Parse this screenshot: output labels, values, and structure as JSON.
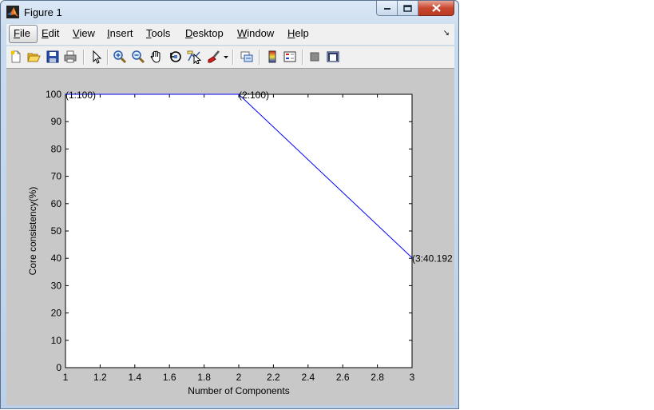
{
  "window": {
    "title": "Figure 1"
  },
  "menu": {
    "items": [
      {
        "mnemonic": "F",
        "rest": "ile"
      },
      {
        "mnemonic": "E",
        "rest": "dit"
      },
      {
        "mnemonic": "V",
        "rest": "iew"
      },
      {
        "mnemonic": "I",
        "rest": "nsert"
      },
      {
        "mnemonic": "T",
        "rest": "ools"
      },
      {
        "mnemonic": "D",
        "rest": "esktop"
      },
      {
        "mnemonic": "W",
        "rest": "indow"
      },
      {
        "mnemonic": "H",
        "rest": "elp"
      }
    ],
    "dock_arrow": "↘"
  },
  "toolbar": {
    "icons": [
      "new-figure-icon",
      "open-file-icon",
      "save-figure-icon",
      "print-figure-icon",
      "edit-plot-icon",
      "zoom-in-icon",
      "zoom-out-icon",
      "pan-icon",
      "rotate-3d-icon",
      "data-cursor-icon",
      "brush-icon",
      "brush-dropdown-icon",
      "link-plot-icon",
      "insert-colorbar-icon",
      "insert-legend-icon",
      "hide-plot-tools-icon",
      "show-plot-tools-icon"
    ]
  },
  "chart_data": {
    "type": "line",
    "x": [
      1,
      2,
      3
    ],
    "series": [
      {
        "values": [
          100,
          100,
          40.192
        ],
        "color": "#0000ff"
      }
    ],
    "data_labels": [
      "(1:100)",
      "(2:100)",
      "(3:40.192"
    ],
    "title": "",
    "xlabel": "Number of Components",
    "ylabel": "Core consistency(%)",
    "xlim": [
      1,
      3
    ],
    "ylim": [
      0,
      100
    ],
    "xticks": [
      1,
      1.2,
      1.4,
      1.6,
      1.8,
      2,
      2.2,
      2.4,
      2.6,
      2.8,
      3
    ],
    "xtick_labels": [
      "1",
      "1.2",
      "1.4",
      "1.6",
      "1.8",
      "2",
      "2.2",
      "2.4",
      "2.6",
      "2.8",
      "3"
    ],
    "yticks": [
      0,
      10,
      20,
      30,
      40,
      50,
      60,
      70,
      80,
      90,
      100
    ],
    "ytick_labels": [
      "0",
      "10",
      "20",
      "30",
      "40",
      "50",
      "60",
      "70",
      "80",
      "90",
      "100"
    ],
    "grid": false,
    "legend": "none"
  }
}
